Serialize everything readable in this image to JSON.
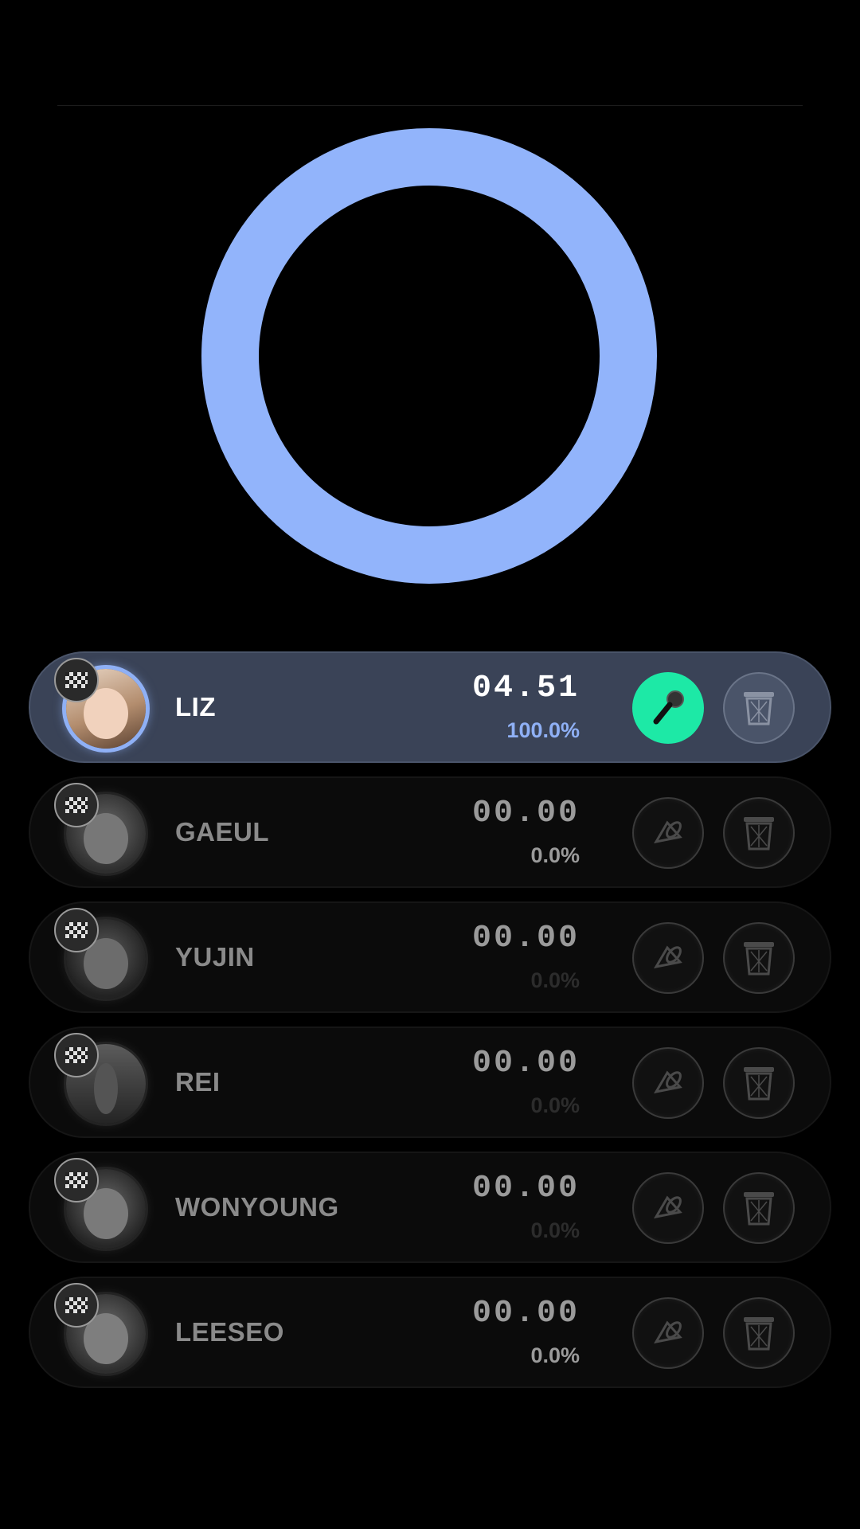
{
  "colors": {
    "accent": "#92b4fb",
    "mic_active": "#1de9a6",
    "active_row": "#3a4357"
  },
  "members": [
    {
      "name": "LIZ",
      "time": "04.51",
      "percent": "100.0%",
      "active": true,
      "mic_icon": "microphone-icon",
      "trash_icon": "trash-icon"
    },
    {
      "name": "GAEUL",
      "time": "00.00",
      "percent": "0.0%",
      "active": false,
      "mic_icon": "speaker-icon",
      "trash_icon": "trash-icon"
    },
    {
      "name": "YUJIN",
      "time": "00.00",
      "percent": "0.0%",
      "active": false,
      "mic_icon": "speaker-icon",
      "trash_icon": "trash-icon"
    },
    {
      "name": "REI",
      "time": "00.00",
      "percent": "0.0%",
      "active": false,
      "mic_icon": "speaker-icon",
      "trash_icon": "trash-icon"
    },
    {
      "name": "WONYOUNG",
      "time": "00.00",
      "percent": "0.0%",
      "active": false,
      "mic_icon": "speaker-icon",
      "trash_icon": "trash-icon"
    },
    {
      "name": "LEESEO",
      "time": "00.00",
      "percent": "0.0%",
      "active": false,
      "mic_icon": "speaker-icon",
      "trash_icon": "trash-icon"
    }
  ]
}
